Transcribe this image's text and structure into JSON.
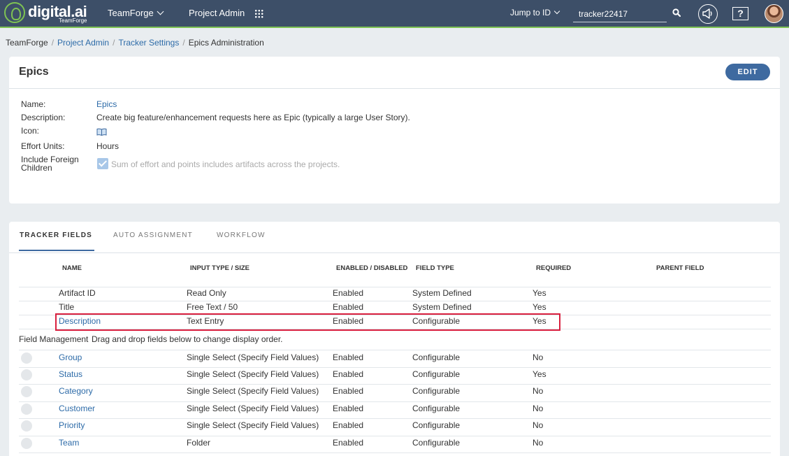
{
  "header": {
    "logo_text": "digital.ai",
    "logo_sub": "TeamForge",
    "nav_teamforge": "TeamForge",
    "nav_project_admin": "Project Admin",
    "jump_to_id": "Jump to ID",
    "jump_value": "tracker22417"
  },
  "breadcrumb": {
    "items": [
      "TeamForge",
      "Project Admin",
      "Tracker Settings",
      "Epics Administration"
    ]
  },
  "tracker": {
    "title": "Epics",
    "edit_label": "EDIT",
    "labels": {
      "name": "Name:",
      "description": "Description:",
      "icon": "Icon:",
      "effort_units": "Effort Units:",
      "include_foreign_1": "Include Foreign",
      "include_foreign_2": "Children"
    },
    "name": "Epics",
    "description": "Create big feature/enhancement requests here as Epic (typically a large User Story).",
    "icon": "book-icon",
    "effort_units": "Hours",
    "include_foreign_label": "Sum of effort and points includes artifacts across the projects.",
    "include_foreign_checked": true
  },
  "tabs": [
    "TRACKER FIELDS",
    "AUTO ASSIGNMENT",
    "WORKFLOW"
  ],
  "columns": [
    "NAME",
    "INPUT TYPE / SIZE",
    "ENABLED / DISABLED",
    "FIELD TYPE",
    "REQUIRED",
    "PARENT FIELD"
  ],
  "system_rows": [
    {
      "name": "Artifact ID",
      "input": "Read Only",
      "enabled": "Enabled",
      "type": "System Defined",
      "required": "Yes",
      "parent": ""
    },
    {
      "name": "Title",
      "input": "Free Text / 50",
      "enabled": "Enabled",
      "type": "System Defined",
      "required": "Yes",
      "parent": ""
    },
    {
      "name": "Description",
      "input": "Text Entry",
      "enabled": "Enabled",
      "type": "Configurable",
      "required": "Yes",
      "parent": ""
    }
  ],
  "field_management": {
    "title": "Field Management",
    "hint": "Drag and drop fields below to change display order."
  },
  "config_rows": [
    {
      "name": "Group",
      "input": "Single Select (Specify Field Values)",
      "enabled": "Enabled",
      "type": "Configurable",
      "required": "No",
      "parent": ""
    },
    {
      "name": "Status",
      "input": "Single Select (Specify Field Values)",
      "enabled": "Enabled",
      "type": "Configurable",
      "required": "Yes",
      "parent": ""
    },
    {
      "name": "Category",
      "input": "Single Select (Specify Field Values)",
      "enabled": "Enabled",
      "type": "Configurable",
      "required": "No",
      "parent": ""
    },
    {
      "name": "Customer",
      "input": "Single Select (Specify Field Values)",
      "enabled": "Enabled",
      "type": "Configurable",
      "required": "No",
      "parent": ""
    },
    {
      "name": "Priority",
      "input": "Single Select (Specify Field Values)",
      "enabled": "Enabled",
      "type": "Configurable",
      "required": "No",
      "parent": ""
    },
    {
      "name": "Team",
      "input": "Folder",
      "enabled": "Enabled",
      "type": "Configurable",
      "required": "No",
      "parent": ""
    }
  ],
  "colors": {
    "header_bg": "#3d4f68",
    "accent_green": "#7ec253",
    "link": "#2d6ba8",
    "button": "#3e6aa0",
    "highlight": "#d9203f"
  }
}
